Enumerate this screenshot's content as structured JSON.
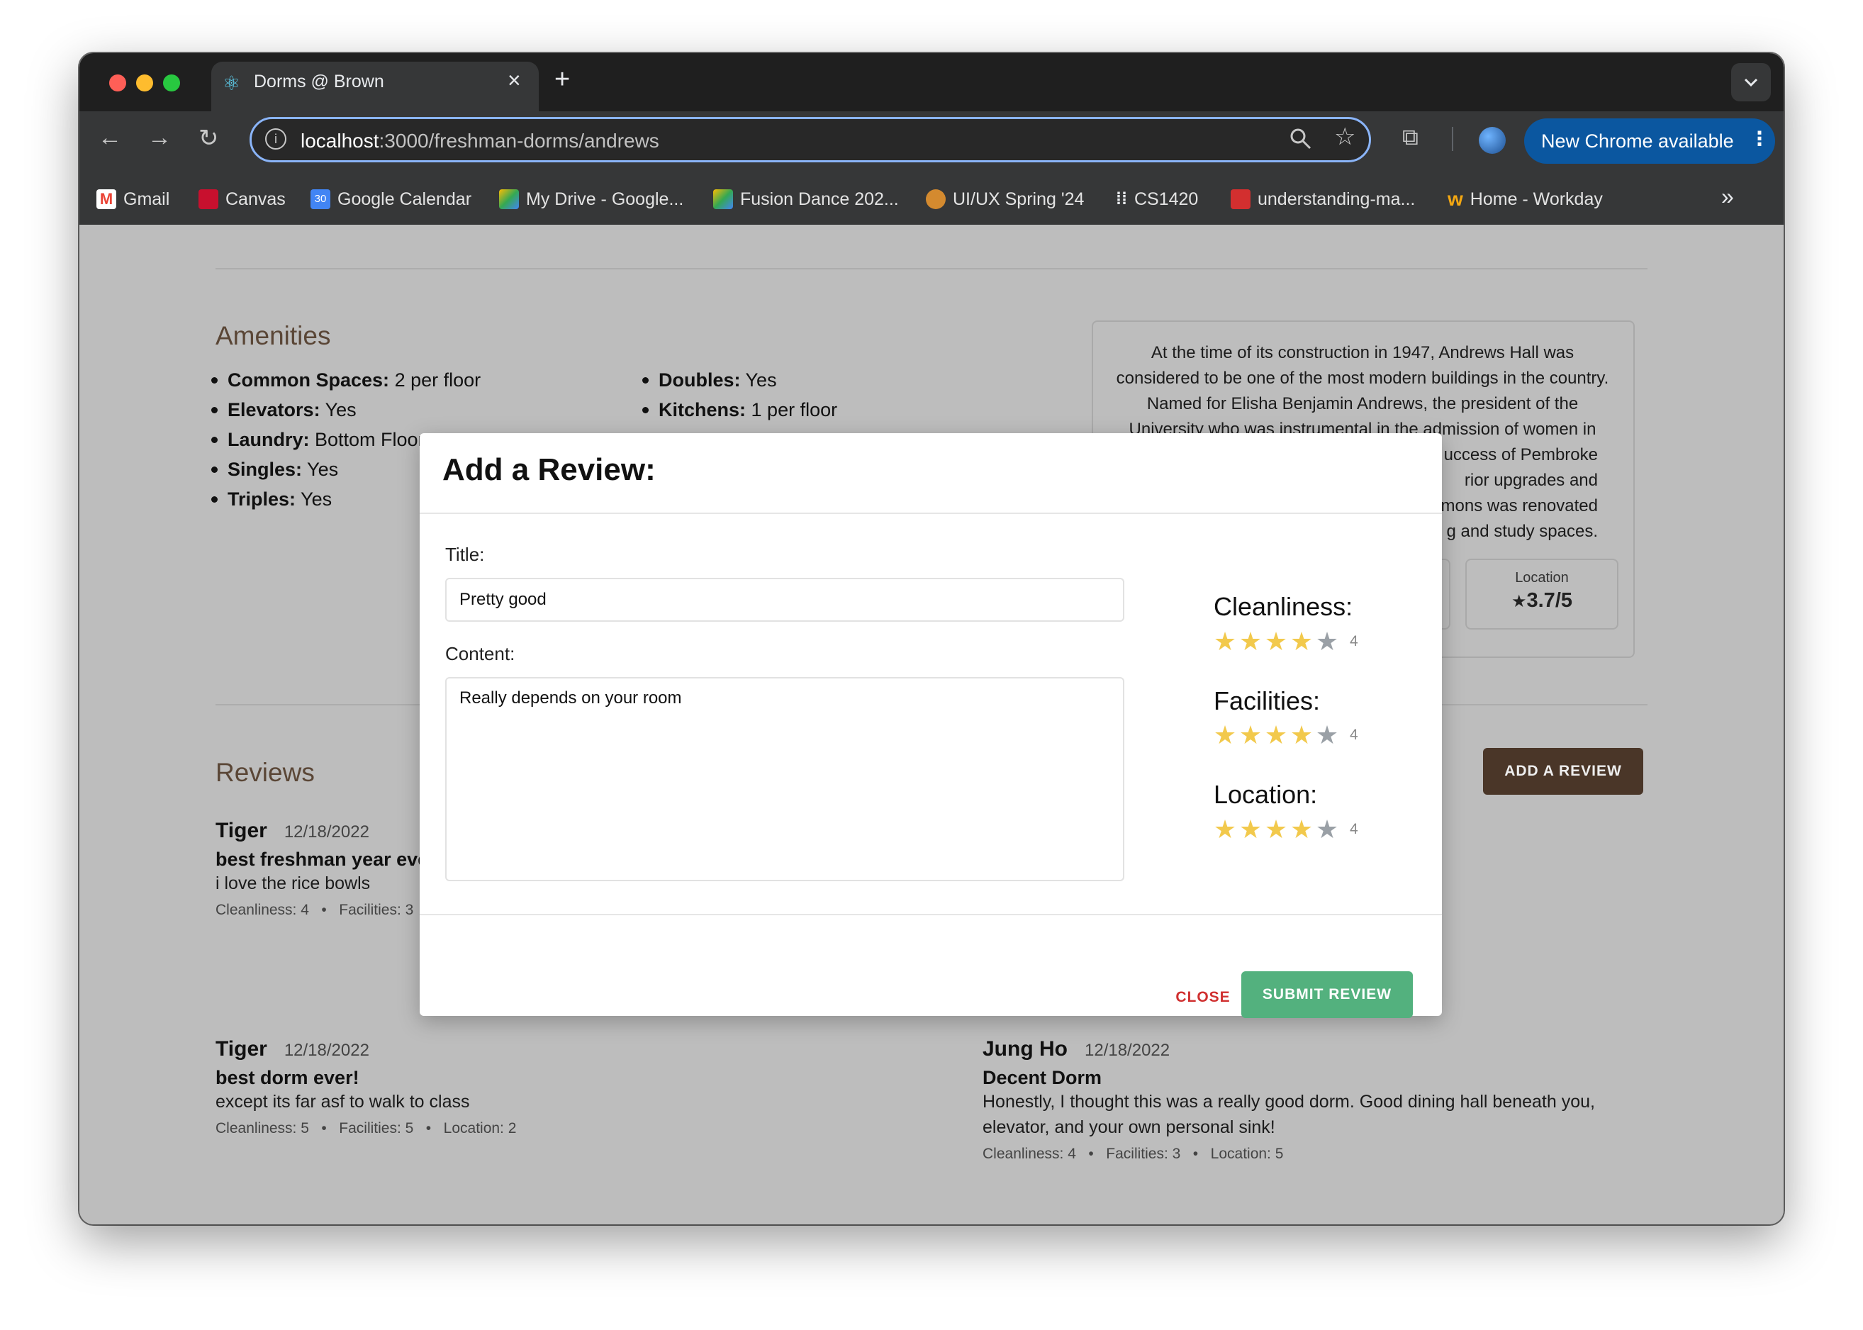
{
  "browser": {
    "tab_title": "Dorms @ Brown",
    "url_host": "localhost",
    "url_path": ":3000/freshman-dorms/andrews",
    "update_label": "New Chrome available",
    "bookmarks": [
      {
        "label": "Gmail",
        "icon": "gmail-icon",
        "color": "#ea4335"
      },
      {
        "label": "Canvas",
        "icon": "canvas-icon",
        "color": "#c8102e"
      },
      {
        "label": "Google Calendar",
        "icon": "calendar-icon",
        "color": "#4285f4"
      },
      {
        "label": "My Drive - Google...",
        "icon": "drive-icon",
        "color": "#fbbc04"
      },
      {
        "label": "Fusion Dance 202...",
        "icon": "drive-icon",
        "color": "#34a853"
      },
      {
        "label": "UI/UX Spring '24",
        "icon": "bear-icon",
        "color": "#d48a2f"
      },
      {
        "label": "CS1420",
        "icon": "dots-icon",
        "color": "#e8eaed"
      },
      {
        "label": "understanding-ma...",
        "icon": "pdf-icon",
        "color": "#d32f2f"
      },
      {
        "label": "Home - Workday",
        "icon": "workday-icon",
        "color": "#0875e1"
      }
    ]
  },
  "amenities": {
    "heading": "Amenities",
    "left": [
      {
        "k": "Common Spaces:",
        "v": " 2 per floor"
      },
      {
        "k": "Elevators:",
        "v": " Yes"
      },
      {
        "k": "Laundry:",
        "v": " Bottom Floor"
      },
      {
        "k": "Singles:",
        "v": " Yes"
      },
      {
        "k": "Triples:",
        "v": " Yes"
      }
    ],
    "right": [
      {
        "k": "Doubles:",
        "v": " Yes"
      },
      {
        "k": "Kitchens:",
        "v": " 1 per floor"
      }
    ]
  },
  "description": {
    "lines": [
      "At the time of its construction in 1947, Andrews Hall was",
      "considered to be one of the most modern buildings in the country.",
      "Named for Elisha Benjamin Andrews, the president of the",
      "University who was instrumental in the admission of women in",
      "uccess of Pembroke",
      "rior upgrades and",
      "mmons was renovated",
      "g and study spaces."
    ],
    "location_label": "Location",
    "location_value": "3.7/5"
  },
  "reviews": {
    "heading": "Reviews",
    "add_button": "ADD A REVIEW",
    "items": [
      {
        "name": "Tiger",
        "date": "12/18/2022",
        "title": "best freshman year eve",
        "body": "i love the rice bowls",
        "meta": "Cleanliness: 4   •   Facilities: 3"
      },
      {
        "name": "Tiger",
        "date": "12/18/2022",
        "title": "best dorm ever!",
        "body": "except its far asf to walk to class",
        "meta": "Cleanliness: 5   •   Facilities: 5   •   Location: 2"
      },
      {
        "name": "Jung Ho",
        "date": "12/18/2022",
        "title": "Decent Dorm",
        "body1": "Honestly, I thought this was a really good dorm. Good dining hall beneath you,",
        "body2": "elevator, and your own personal sink!",
        "meta": "Cleanliness: 4   •   Facilities: 3   •   Location: 5"
      }
    ]
  },
  "modal": {
    "title": "Add a Review:",
    "title_label": "Title:",
    "title_value": "Pretty good",
    "content_label": "Content:",
    "content_value": "Really depends on your room",
    "ratings": [
      {
        "label": "Cleanliness:",
        "value": 4,
        "value_text": "4"
      },
      {
        "label": "Facilities:",
        "value": 4,
        "value_text": "4"
      },
      {
        "label": "Location:",
        "value": 4,
        "value_text": "4"
      }
    ],
    "close_label": "CLOSE",
    "submit_label": "SUBMIT REVIEW"
  },
  "colors": {
    "star_filled": "#f2c94c",
    "star_empty": "#9aa0a6",
    "accent_brown": "#4a3628",
    "submit_green": "#53b17e"
  }
}
